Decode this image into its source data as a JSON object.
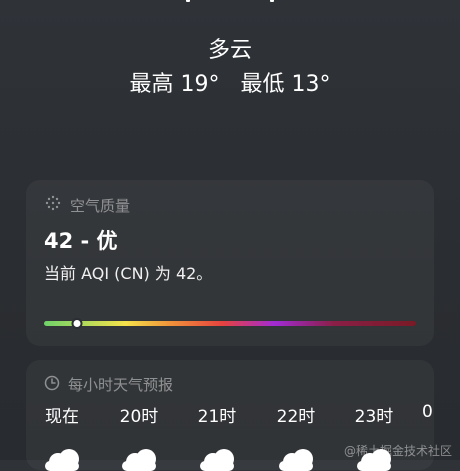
{
  "weather": {
    "condition": "多云",
    "high": "最高 19°",
    "low": "最低 13°"
  },
  "aqi": {
    "title": "空气质量",
    "value_text": "42 - 优",
    "description": "当前 AQI (CN) 为 42。",
    "level_fraction": 0.09
  },
  "hourly": {
    "title": "每小时天气预报",
    "hours": [
      "现在",
      "20时",
      "21时",
      "22时",
      "23时",
      "0"
    ]
  },
  "icons": {
    "aqi": "air-quality-icon",
    "hourly": "clock-icon",
    "hour_condition": "cloud-icon"
  },
  "watermark": "@稀土掘金技术社区"
}
